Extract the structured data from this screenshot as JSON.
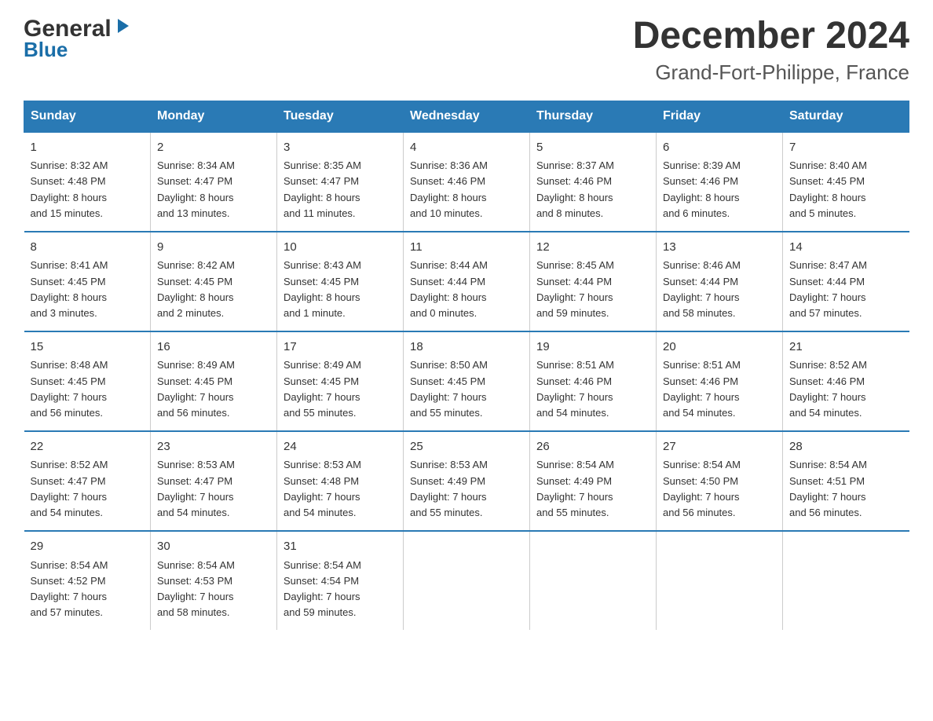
{
  "header": {
    "title": "December 2024",
    "subtitle": "Grand-Fort-Philippe, France",
    "logo_general": "General",
    "logo_blue": "Blue"
  },
  "days_of_week": [
    "Sunday",
    "Monday",
    "Tuesday",
    "Wednesday",
    "Thursday",
    "Friday",
    "Saturday"
  ],
  "weeks": [
    [
      {
        "day": "1",
        "info": "Sunrise: 8:32 AM\nSunset: 4:48 PM\nDaylight: 8 hours\nand 15 minutes."
      },
      {
        "day": "2",
        "info": "Sunrise: 8:34 AM\nSunset: 4:47 PM\nDaylight: 8 hours\nand 13 minutes."
      },
      {
        "day": "3",
        "info": "Sunrise: 8:35 AM\nSunset: 4:47 PM\nDaylight: 8 hours\nand 11 minutes."
      },
      {
        "day": "4",
        "info": "Sunrise: 8:36 AM\nSunset: 4:46 PM\nDaylight: 8 hours\nand 10 minutes."
      },
      {
        "day": "5",
        "info": "Sunrise: 8:37 AM\nSunset: 4:46 PM\nDaylight: 8 hours\nand 8 minutes."
      },
      {
        "day": "6",
        "info": "Sunrise: 8:39 AM\nSunset: 4:46 PM\nDaylight: 8 hours\nand 6 minutes."
      },
      {
        "day": "7",
        "info": "Sunrise: 8:40 AM\nSunset: 4:45 PM\nDaylight: 8 hours\nand 5 minutes."
      }
    ],
    [
      {
        "day": "8",
        "info": "Sunrise: 8:41 AM\nSunset: 4:45 PM\nDaylight: 8 hours\nand 3 minutes."
      },
      {
        "day": "9",
        "info": "Sunrise: 8:42 AM\nSunset: 4:45 PM\nDaylight: 8 hours\nand 2 minutes."
      },
      {
        "day": "10",
        "info": "Sunrise: 8:43 AM\nSunset: 4:45 PM\nDaylight: 8 hours\nand 1 minute."
      },
      {
        "day": "11",
        "info": "Sunrise: 8:44 AM\nSunset: 4:44 PM\nDaylight: 8 hours\nand 0 minutes."
      },
      {
        "day": "12",
        "info": "Sunrise: 8:45 AM\nSunset: 4:44 PM\nDaylight: 7 hours\nand 59 minutes."
      },
      {
        "day": "13",
        "info": "Sunrise: 8:46 AM\nSunset: 4:44 PM\nDaylight: 7 hours\nand 58 minutes."
      },
      {
        "day": "14",
        "info": "Sunrise: 8:47 AM\nSunset: 4:44 PM\nDaylight: 7 hours\nand 57 minutes."
      }
    ],
    [
      {
        "day": "15",
        "info": "Sunrise: 8:48 AM\nSunset: 4:45 PM\nDaylight: 7 hours\nand 56 minutes."
      },
      {
        "day": "16",
        "info": "Sunrise: 8:49 AM\nSunset: 4:45 PM\nDaylight: 7 hours\nand 56 minutes."
      },
      {
        "day": "17",
        "info": "Sunrise: 8:49 AM\nSunset: 4:45 PM\nDaylight: 7 hours\nand 55 minutes."
      },
      {
        "day": "18",
        "info": "Sunrise: 8:50 AM\nSunset: 4:45 PM\nDaylight: 7 hours\nand 55 minutes."
      },
      {
        "day": "19",
        "info": "Sunrise: 8:51 AM\nSunset: 4:46 PM\nDaylight: 7 hours\nand 54 minutes."
      },
      {
        "day": "20",
        "info": "Sunrise: 8:51 AM\nSunset: 4:46 PM\nDaylight: 7 hours\nand 54 minutes."
      },
      {
        "day": "21",
        "info": "Sunrise: 8:52 AM\nSunset: 4:46 PM\nDaylight: 7 hours\nand 54 minutes."
      }
    ],
    [
      {
        "day": "22",
        "info": "Sunrise: 8:52 AM\nSunset: 4:47 PM\nDaylight: 7 hours\nand 54 minutes."
      },
      {
        "day": "23",
        "info": "Sunrise: 8:53 AM\nSunset: 4:47 PM\nDaylight: 7 hours\nand 54 minutes."
      },
      {
        "day": "24",
        "info": "Sunrise: 8:53 AM\nSunset: 4:48 PM\nDaylight: 7 hours\nand 54 minutes."
      },
      {
        "day": "25",
        "info": "Sunrise: 8:53 AM\nSunset: 4:49 PM\nDaylight: 7 hours\nand 55 minutes."
      },
      {
        "day": "26",
        "info": "Sunrise: 8:54 AM\nSunset: 4:49 PM\nDaylight: 7 hours\nand 55 minutes."
      },
      {
        "day": "27",
        "info": "Sunrise: 8:54 AM\nSunset: 4:50 PM\nDaylight: 7 hours\nand 56 minutes."
      },
      {
        "day": "28",
        "info": "Sunrise: 8:54 AM\nSunset: 4:51 PM\nDaylight: 7 hours\nand 56 minutes."
      }
    ],
    [
      {
        "day": "29",
        "info": "Sunrise: 8:54 AM\nSunset: 4:52 PM\nDaylight: 7 hours\nand 57 minutes."
      },
      {
        "day": "30",
        "info": "Sunrise: 8:54 AM\nSunset: 4:53 PM\nDaylight: 7 hours\nand 58 minutes."
      },
      {
        "day": "31",
        "info": "Sunrise: 8:54 AM\nSunset: 4:54 PM\nDaylight: 7 hours\nand 59 minutes."
      },
      {
        "day": "",
        "info": ""
      },
      {
        "day": "",
        "info": ""
      },
      {
        "day": "",
        "info": ""
      },
      {
        "day": "",
        "info": ""
      }
    ]
  ]
}
